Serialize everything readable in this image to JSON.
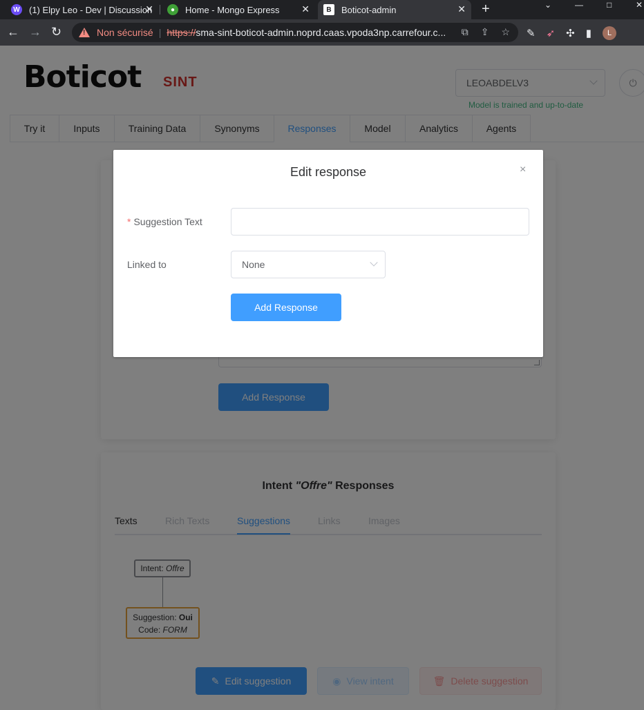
{
  "browser": {
    "tabs": [
      {
        "title": "(1) Elpy Leo - Dev | Discussion",
        "icon": "elpy-icon"
      },
      {
        "title": "Home - Mongo Express",
        "icon": "mongo-leaf-icon"
      },
      {
        "title": "Boticot-admin",
        "icon": "boticot-icon",
        "active": true
      }
    ],
    "security_label": "Non sécurisé",
    "url_scheme": "https://",
    "url_rest": "sma-sint-boticot-admin.noprd.caas.vpoda3np.carrefour.c...",
    "profile_initial": "L"
  },
  "app": {
    "logo": "Boticot",
    "env": "SINT",
    "agent": "LEOABDELV3",
    "model_status": "Model is trained and up-to-date",
    "nav_tabs": [
      "Try it",
      "Inputs",
      "Training Data",
      "Synonyms",
      "Responses",
      "Model",
      "Analytics",
      "Agents"
    ],
    "active_tab": "Responses",
    "bg_add_button": "Add Response",
    "intent_card": {
      "title_prefix": "Intent ",
      "intent_name": "\"Offre\"",
      "title_suffix": " Responses",
      "tabs": [
        "Texts",
        "Rich Texts",
        "Suggestions",
        "Links",
        "Images"
      ],
      "active_tab": "Suggestions",
      "node_intent_label": "Intent: ",
      "node_intent_value": "Offre",
      "node_sugg_label": "Suggestion: ",
      "node_sugg_value": "Oui",
      "node_code_label": "Code: ",
      "node_code_value": "FORM",
      "edit_button": "Edit suggestion",
      "view_button": "View intent",
      "delete_button": "Delete suggestion"
    }
  },
  "dialog": {
    "title": "Edit response",
    "close": "×",
    "suggestion_label": "Suggestion Text",
    "required_mark": "*",
    "suggestion_value": "",
    "linked_label": "Linked to",
    "linked_value": "None",
    "submit_button": "Add Response"
  },
  "colors": {
    "primary": "#409eff",
    "env": "#d0312d",
    "status_ok": "#42b983",
    "danger": "#f56c6c"
  }
}
